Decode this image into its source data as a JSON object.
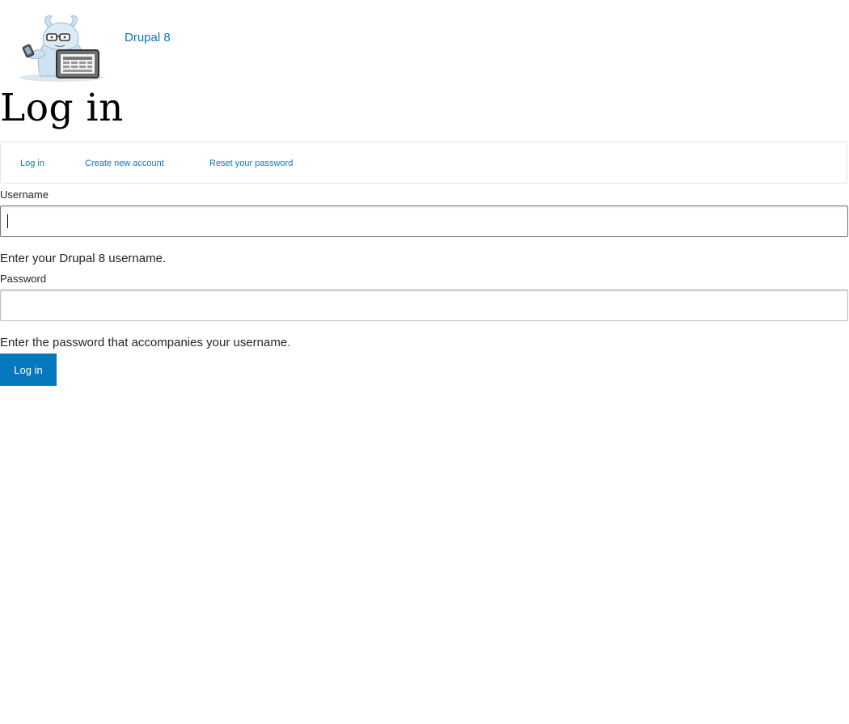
{
  "site": {
    "name": "Drupal 8"
  },
  "page": {
    "title": "Log in"
  },
  "tabs": [
    {
      "label": "Log in"
    },
    {
      "label": "Create new account"
    },
    {
      "label": "Reset your password"
    }
  ],
  "form": {
    "username": {
      "label": "Username",
      "value": "",
      "description": "Enter your Drupal 8 username."
    },
    "password": {
      "label": "Password",
      "value": "",
      "description": "Enter the password that accompanies your username."
    },
    "submit_label": "Log in"
  },
  "colors": {
    "link": "#0678be",
    "button_bg": "#0678be",
    "button_text": "#ffffff",
    "text": "#232429",
    "border": "#e6e6e6"
  },
  "icons": {
    "logo": "druplicon-mascot-logo"
  }
}
